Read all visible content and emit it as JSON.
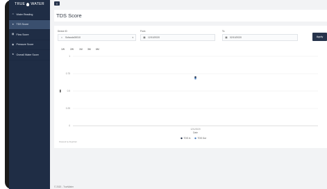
{
  "brand": {
    "name_left": "TRUE",
    "name_right": "WATER"
  },
  "sidebar": {
    "items": [
      {
        "label": "Water Reading",
        "icon": "home-icon",
        "active": false
      },
      {
        "label": "TDS Score",
        "icon": "user-icon",
        "active": true
      },
      {
        "label": "Flow Score",
        "icon": "file-icon",
        "active": false
      },
      {
        "label": "Pressure Score",
        "icon": "pin-icon",
        "active": false
      },
      {
        "label": "Overall Water Score",
        "icon": "star-icon",
        "active": false
      }
    ]
  },
  "page": {
    "title": "TDS Score"
  },
  "filters": {
    "device_label": "Device ID",
    "device_value": "Sofaudo00010",
    "from_label": "From",
    "from_value": "12/10/2020",
    "to_label": "To",
    "to_value": "02/10/2020",
    "apply_label": "Apply"
  },
  "ranges": [
    "1W",
    "2W",
    "1M",
    "3M",
    "6M"
  ],
  "chart_data": {
    "type": "scatter",
    "title": "",
    "xlabel": "Date",
    "ylabel": "",
    "categories": [
      "12/1/2020"
    ],
    "yticks": [
      "1",
      "0.75",
      "0.5",
      "0.25",
      "0"
    ],
    "ylim": [
      0,
      1
    ],
    "series": [
      {
        "name": "TDS In",
        "values": [
          0.7
        ],
        "color": "#1f2d45"
      },
      {
        "name": "TDS Out",
        "values": [
          0.68
        ],
        "color": "#4a7fbf"
      }
    ],
    "legend": "bottom"
  },
  "chart_credit": "Powered by ZingChart",
  "footer": "© 2020 - TrueWater"
}
